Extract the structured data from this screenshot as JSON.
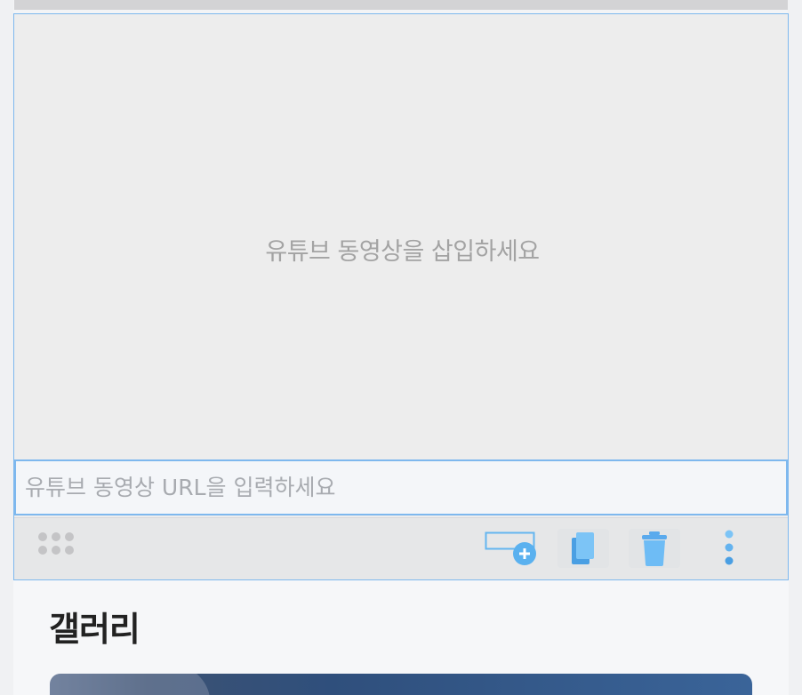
{
  "video_block": {
    "placeholder_text": "유튜브 동영상을 삽입하세요",
    "url_input": {
      "value": "",
      "placeholder": "유튜브 동영상 URL을 입력하세요"
    }
  },
  "toolbar": {
    "items": [
      {
        "name": "drag-handle",
        "icon": "drag-dots-icon"
      },
      {
        "name": "add-block",
        "icon": "add-block-icon"
      },
      {
        "name": "copy",
        "icon": "copy-icon"
      },
      {
        "name": "delete",
        "icon": "trash-icon"
      },
      {
        "name": "more",
        "icon": "more-vertical-icon"
      }
    ]
  },
  "gallery": {
    "title": "갤러리"
  },
  "colors": {
    "accent": "#7eb8ee",
    "icon_blue": "#64b6ef",
    "placeholder_gray": "#a3a3a3"
  }
}
